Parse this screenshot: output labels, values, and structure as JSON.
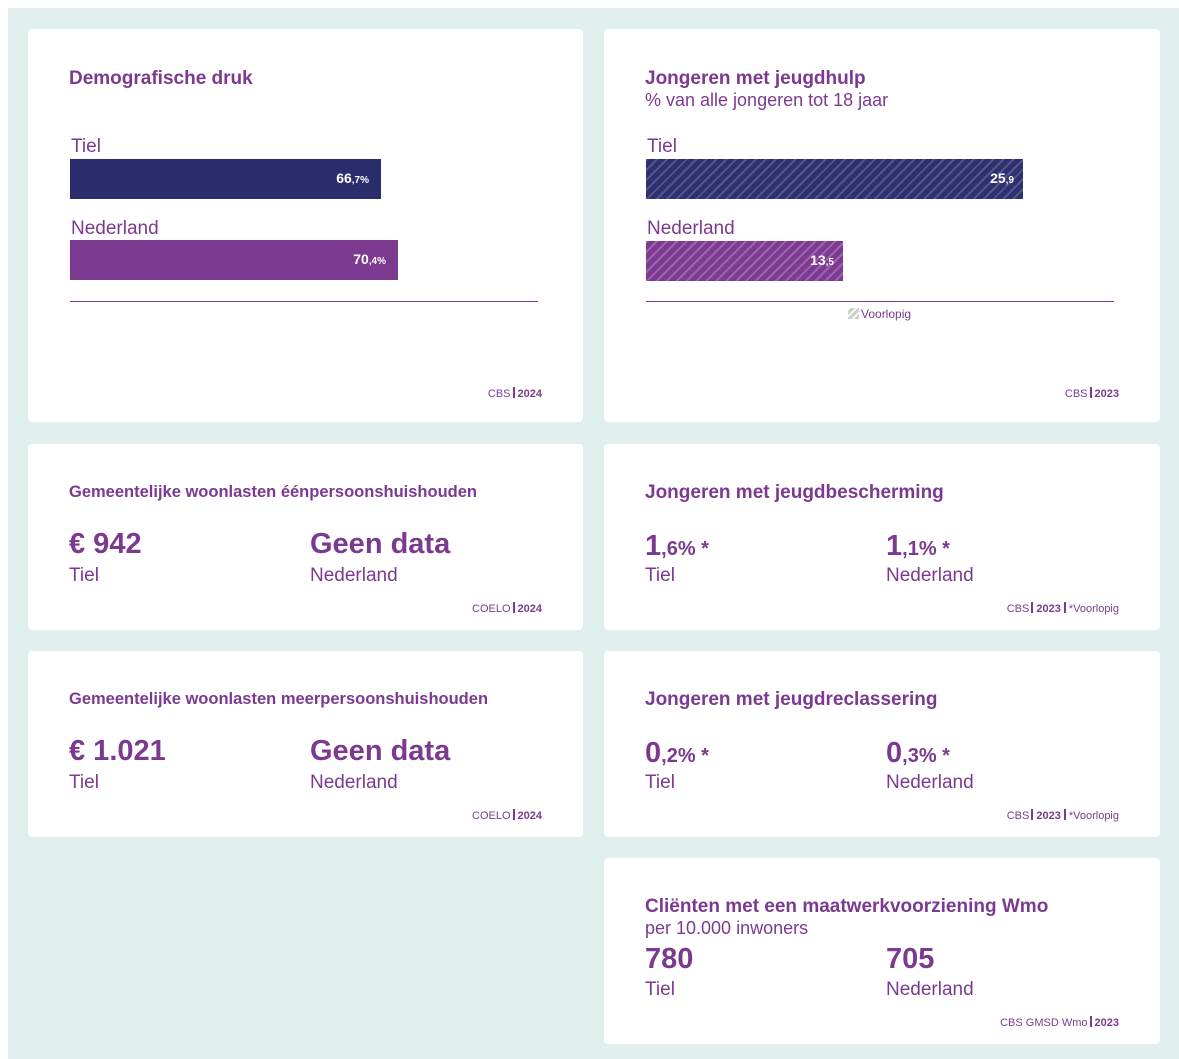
{
  "demografische_druk": {
    "title": "Demografische druk",
    "source_org": "CBS",
    "source_year": "2024",
    "bars": [
      {
        "label": "Tiel",
        "value_main": "66",
        "value_dec": ",7%",
        "value": 66.7,
        "color": "#2a2c6c"
      },
      {
        "label": "Nederland",
        "value_main": "70",
        "value_dec": ",4%",
        "value": 70.4,
        "color": "#7b3a90"
      }
    ]
  },
  "jeugdhulp": {
    "title": "Jongeren met jeugdhulp",
    "subtitle": "% van alle jongeren tot 18 jaar",
    "legend": "Voorlopig",
    "source_org": "CBS",
    "source_year": "2023",
    "bars": [
      {
        "label": "Tiel",
        "value_main": "25",
        "value_dec": ",9",
        "value": 25.9,
        "color": "#2d2f6e"
      },
      {
        "label": "Nederland",
        "value_main": "13",
        "value_dec": ",5",
        "value": 13.5,
        "color": "#7e3a92"
      }
    ]
  },
  "woonlasten_een": {
    "title": "Gemeentelijke woonlasten éénpersoonshuishouden",
    "left_value": "€ 942",
    "left_place": "Tiel",
    "right_value": "Geen data",
    "right_place": "Nederland",
    "source_org": "COELO",
    "source_year": "2024"
  },
  "jeugdbescherming": {
    "title": "Jongeren met jeugdbescherming",
    "left_main": "1",
    "left_dec": ",6%",
    "left_star": " *",
    "left_place": "Tiel",
    "right_main": "1",
    "right_dec": ",1%",
    "right_star": " *",
    "right_place": "Nederland",
    "source_org": "CBS",
    "source_year": "2023",
    "source_note": "*Voorlopig"
  },
  "woonlasten_meer": {
    "title": "Gemeentelijke woonlasten meerpersoonshuishouden",
    "left_value": "€ 1.021",
    "left_place": "Tiel",
    "right_value": "Geen data",
    "right_place": "Nederland",
    "source_org": "COELO",
    "source_year": "2024"
  },
  "jeugdreclassering": {
    "title": "Jongeren met jeugdreclassering",
    "left_main": "0",
    "left_dec": ",2%",
    "left_star": " *",
    "left_place": "Tiel",
    "right_main": "0",
    "right_dec": ",3%",
    "right_star": " *",
    "right_place": "Nederland",
    "source_org": "CBS",
    "source_year": "2023",
    "source_note": "*Voorlopig"
  },
  "wmo": {
    "title": "Cliënten met een maatwerkvoorziening Wmo",
    "subtitle": "per 10.000 inwoners",
    "left_value": "780",
    "left_place": "Tiel",
    "right_value": "705",
    "right_place": "Nederland",
    "source_org": "CBS GMSD Wmo",
    "source_year": "2023"
  }
}
